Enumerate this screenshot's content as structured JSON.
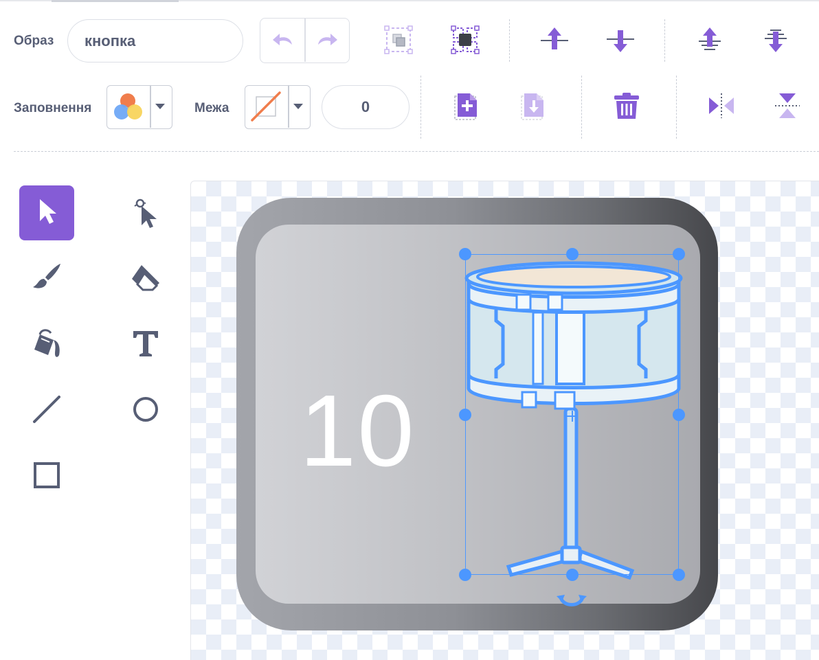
{
  "costume": {
    "label": "Образ",
    "name": "кнопка"
  },
  "fill": {
    "label": "Заповнення"
  },
  "outline": {
    "label": "Межа",
    "width": "0"
  },
  "canvas": {
    "costume_number": "10"
  },
  "colors": {
    "accent": "#855cd6",
    "accent_light": "#c8b6f0",
    "text": "#575e75",
    "selection": "#4c97ff"
  },
  "icons": {
    "undo": "undo-icon",
    "redo": "redo-icon",
    "group": "group-icon",
    "ungroup": "ungroup-icon",
    "forward": "forward-icon",
    "backward": "backward-icon",
    "front": "front-icon",
    "back": "back-icon",
    "copy": "copy-icon",
    "paste": "paste-icon",
    "delete": "delete-icon",
    "flip_h": "flip-horizontal-icon",
    "flip_v": "flip-vertical-icon"
  },
  "tools": [
    "select",
    "reshape",
    "brush",
    "eraser",
    "fill",
    "text",
    "line",
    "circle",
    "rectangle"
  ],
  "selected_tool": "select"
}
